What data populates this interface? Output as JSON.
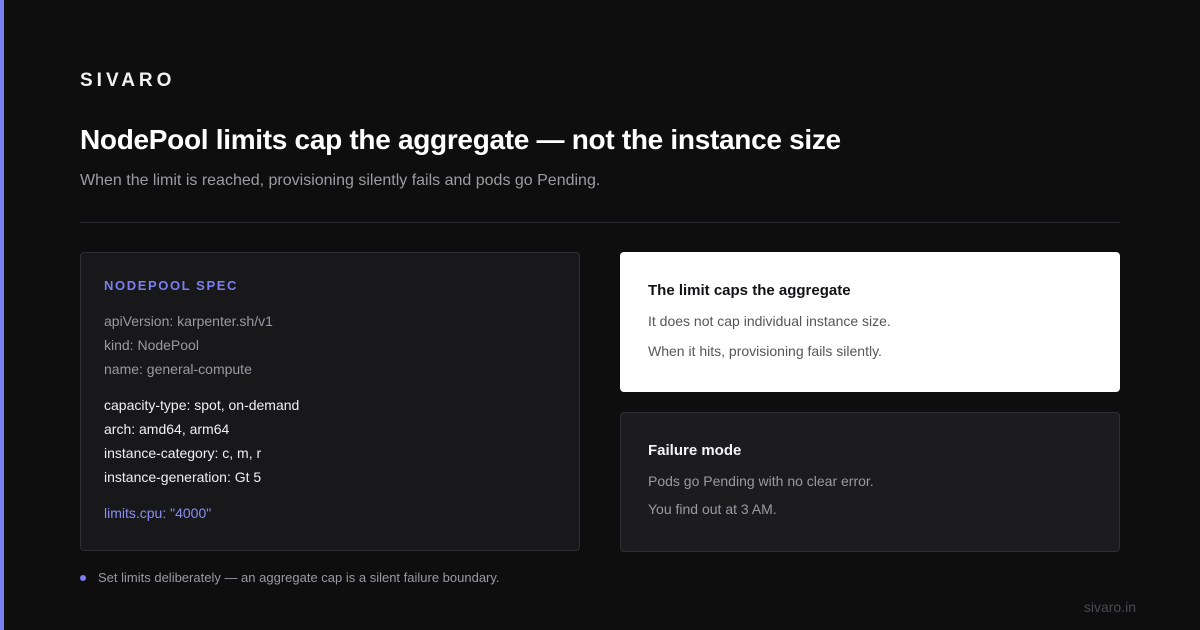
{
  "brand": "SIVARO",
  "header": {
    "title": "NodePool limits cap the aggregate — not the instance size",
    "subtitle": "When the limit is reached, provisioning silently fails and pods go Pending."
  },
  "spec": {
    "heading": "NODEPOOL SPEC",
    "meta_lines": [
      "apiVersion: karpenter.sh/v1",
      "kind: NodePool",
      "name: general-compute"
    ],
    "requirement_lines": [
      "capacity-type: spot, on-demand",
      "arch: amd64, arm64",
      "instance-category: c, m, r",
      "instance-generation: Gt 5"
    ],
    "limit_line": "limits.cpu: \"4000\""
  },
  "card_limit": {
    "title": "The limit caps the aggregate",
    "lines": [
      "It does not cap individual instance size.",
      "When it hits, provisioning fails silently."
    ]
  },
  "card_failure": {
    "title": "Failure mode",
    "lines": [
      "Pods go Pending with no clear error.",
      "You find out at 3 AM."
    ]
  },
  "note": "Set limits deliberately — an aggregate cap is a silent failure boundary.",
  "footer_domain": "sivaro.in",
  "colors": {
    "accent": "#7b7ff0",
    "background": "#0e0e0f"
  }
}
